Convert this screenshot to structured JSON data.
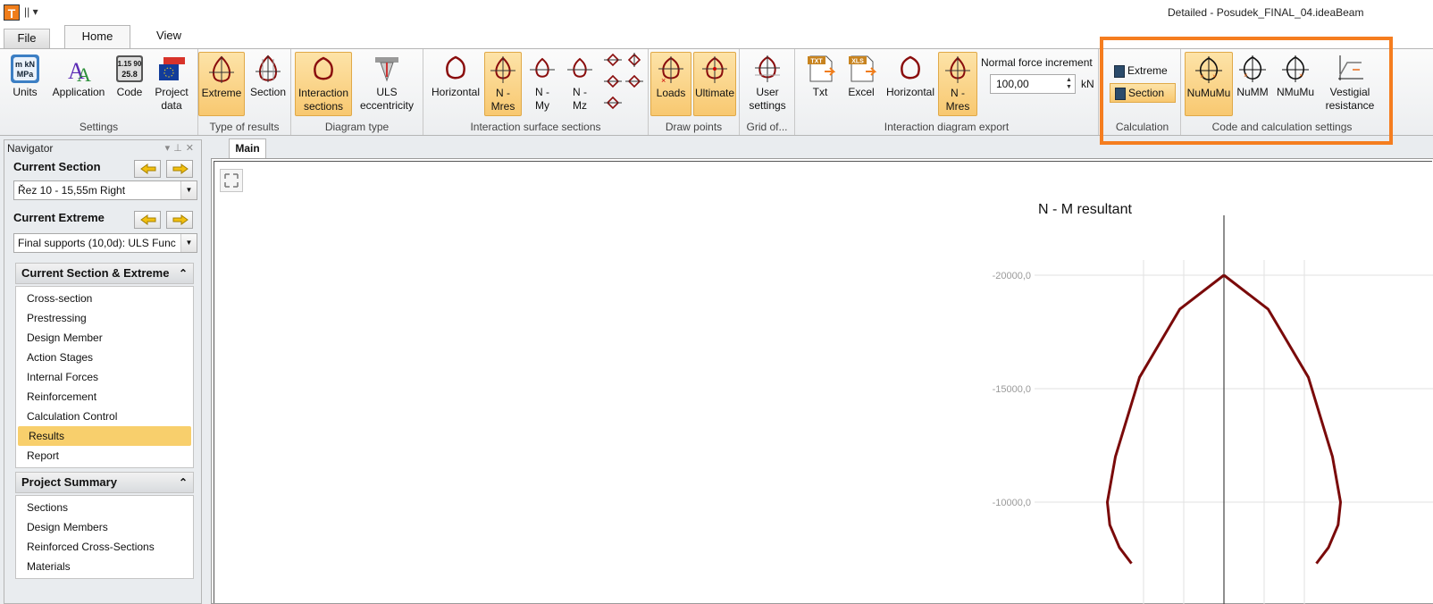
{
  "titlebar": {
    "logo": "T",
    "qat": "|| ▾",
    "title": "Detailed - Posudek_FINAL_04.ideaBeam"
  },
  "tabs": {
    "file": "File",
    "home": "Home",
    "view": "View"
  },
  "ribbon": {
    "settings": {
      "label": "Settings",
      "units": "Units",
      "application": "Application",
      "code": "Code",
      "project_data_1": "Project",
      "project_data_2": "data"
    },
    "type_of_results": {
      "label": "Type of results",
      "extreme": "Extreme",
      "section": "Section"
    },
    "diagram_type": {
      "label": "Diagram type",
      "interaction_1": "Interaction",
      "interaction_2": "sections",
      "uls_1": "ULS",
      "uls_2": "eccentricity"
    },
    "interaction_surface": {
      "label": "Interaction surface sections",
      "horizontal": "Horizontal",
      "nmres_1": "N -",
      "nmres_2": "Mres",
      "nmy_1": "N -",
      "nmy_2": "My",
      "nmz_1": "N -",
      "nmz_2": "Mz"
    },
    "draw_points": {
      "label": "Draw points",
      "loads": "Loads",
      "ultimate": "Ultimate"
    },
    "grid": {
      "label": "Grid of...",
      "user_1": "User",
      "user_2": "settings"
    },
    "export": {
      "label": "Interaction diagram export",
      "txt": "Txt",
      "excel": "Excel",
      "horizontal": "Horizontal",
      "nmres_1": "N -",
      "nmres_2": "Mres",
      "nf_label": "Normal force increment",
      "nf_value": "100,00",
      "nf_unit": "kN"
    },
    "calculation": {
      "label": "Calculation",
      "extreme": "Extreme",
      "section": "Section"
    },
    "code_settings": {
      "label": "Code and calculation settings",
      "numumu": "NuMuMu",
      "numm": "NuMM",
      "nmumu": "NMuMu",
      "vest_1": "Vestigial",
      "vest_2": "resistance"
    }
  },
  "navigator": {
    "title": "Navigator",
    "current_section_label": "Current Section",
    "current_section_value": "Řez 10 - 15,55m Right",
    "current_extreme_label": "Current Extreme",
    "current_extreme_value": "Final supports (10,0d): ULS Func",
    "panel1_title": "Current Section & Extreme",
    "panel1_items": [
      "Cross-section",
      "Prestressing",
      "Design Member",
      "Action Stages",
      "Internal Forces",
      "Reinforcement",
      "Calculation Control",
      "Results",
      "Report"
    ],
    "panel1_selected": "Results",
    "panel2_title": "Project Summary",
    "panel2_items": [
      "Sections",
      "Design Members",
      "Reinforced Cross-Sections",
      "Materials"
    ]
  },
  "main": {
    "tab": "Main"
  },
  "chart_data": {
    "type": "line",
    "title": "N - M resultant",
    "y_ticks": [
      "-20000,0",
      "-15000,0",
      "-10000,0"
    ],
    "series": [
      {
        "x": [
          0,
          -5500,
          -10500,
          -13500,
          -14500,
          -14200,
          -13000,
          -11500
        ],
        "y": [
          -20000,
          -18500,
          -15500,
          -12000,
          -10000,
          -9000,
          -8000,
          -7300
        ]
      },
      {
        "x": [
          0,
          5500,
          10500,
          13500,
          14500,
          14200,
          13000,
          11500
        ],
        "y": [
          -20000,
          -18500,
          -15500,
          -12000,
          -10000,
          -9000,
          -8000,
          -7300
        ]
      }
    ],
    "curve_color": "#7a0a0a",
    "grid": true
  }
}
